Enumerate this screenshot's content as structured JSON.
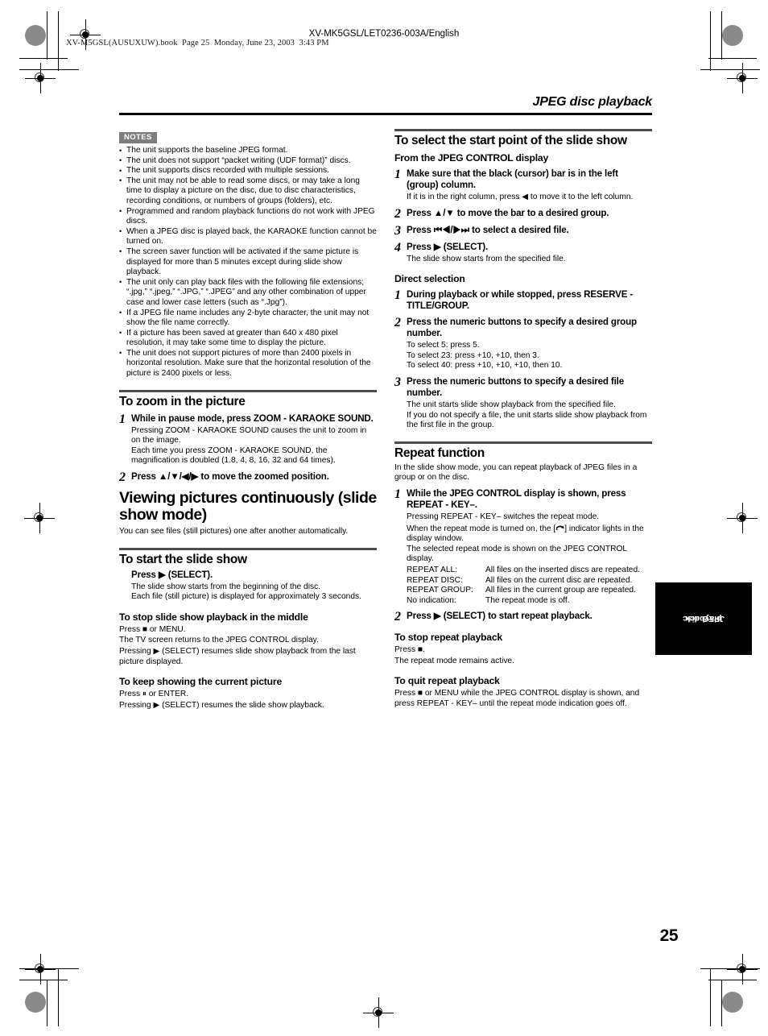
{
  "print": {
    "filestamp": "XV-M5GSL(AUSUXUW).book  Page 25  Monday, June 23, 2003  3:43 PM",
    "model_header": "XV-MK5GSL/LET0236-003A/English",
    "page_number": "25"
  },
  "chapter": {
    "title": "JPEG disc playback",
    "side_tab_line1": "JPEG disc",
    "side_tab_line2": "playback"
  },
  "notes": {
    "badge": "NOTES",
    "items": [
      "The unit supports the baseline JPEG format.",
      "The unit does not support “packet writing (UDF format)” discs.",
      "The unit supports discs recorded with multiple sessions.",
      "The unit may not be able to read some discs, or may take a long time to display a picture on the disc, due to disc characteristics, recording conditions, or numbers of groups (folders), etc.",
      "Programmed and random playback functions do not work with JPEG discs.",
      "When a JPEG disc is played back, the KARAOKE function cannot be turned on.",
      "The screen saver function will be activated if the same picture is displayed for more than 5 minutes except during slide show playback.",
      "The unit only can play back files with the following file extensions; “.jpg,” “.jpeg,” “.JPG,” “.JPEG” and any other combination of upper case and lower case letters (such as “.Jpg”).",
      "If a JPEG file name includes any 2-byte character, the unit may not show the file name correctly.",
      "If a picture has been saved at greater than 640 x 480 pixel resolution, it may take some time to display the picture.",
      "The unit does not support pictures of more than 2400 pixels in horizontal resolution. Make sure that the horizontal resolution of the picture is 2400 pixels or less."
    ]
  },
  "zoom_section": {
    "heading": "To zoom in the picture",
    "step1_num": "1",
    "step1_title": "While in pause mode, press ZOOM - KARAOKE SOUND.",
    "step1_note_a": "Pressing ZOOM - KARAOKE SOUND causes the unit to zoom in on the image.",
    "step1_note_b": "Each time you press ZOOM - KARAOKE SOUND, the magnification is doubled (1.8, 4, 8, 16, 32 and 64 times).",
    "step2_num": "2",
    "step2_title": "Press ▲/▼/◀/▶ to move the zoomed position."
  },
  "slideshow": {
    "title": "Viewing pictures continuously (slide show mode)",
    "lead": "You can see files (still pictures) one after another automatically.",
    "start_heading": "To start the slide show",
    "start_press": "Press ▶ (SELECT).",
    "start_note_a": "The slide show starts from the beginning of the disc.",
    "start_note_b": "Each file (still picture) is displayed for approximately 3 seconds.",
    "stop_heading": "To stop slide show playback in the middle",
    "stop_note_a": "Press ■ or MENU.",
    "stop_note_b": "The TV screen returns to the JPEG CONTROL display.",
    "stop_note_c": "Pressing ▶ (SELECT) resumes slide show playback from the last picture displayed.",
    "keep_heading": "To keep showing the current picture",
    "keep_note_a": "Press ⏸ or ENTER.",
    "keep_note_b": "Pressing ▶ (SELECT)  resumes the slide show playback."
  },
  "startpoint": {
    "heading": "To select the start point of the slide show",
    "from_display_heading": "From the JPEG CONTROL display",
    "steps": [
      {
        "num": "1",
        "title": "Make sure that the black (cursor) bar is in the left (group) column.",
        "note": "If it is in the right column, press ◀ to move it to the left column."
      },
      {
        "num": "2",
        "title": "Press ▲/▼  to move the bar to a desired group.",
        "note": ""
      },
      {
        "num": "3",
        "title": "Press ⏮◀/▶⏭  to select a desired file.",
        "note": ""
      },
      {
        "num": "4",
        "title": "Press ▶ (SELECT).",
        "note": "The slide show starts from the specified file."
      }
    ],
    "direct_heading": "Direct selection",
    "direct_steps": [
      {
        "num": "1",
        "title": "During playback or while stopped, press RESERVE - TITLE/GROUP.",
        "notes": []
      },
      {
        "num": "2",
        "title": "Press the numeric buttons to specify a desired group number.",
        "notes": [
          "To select 5: press 5.",
          "To select 23: press +10, +10, then 3.",
          "To select 40: press +10, +10, +10, then 10."
        ]
      },
      {
        "num": "3",
        "title": "Press the numeric buttons to specify a desired file number.",
        "notes": [
          "The unit starts slide show playback from the specified file.",
          "If you do not specify a file, the unit starts slide show playback from the first file in the group."
        ]
      }
    ]
  },
  "repeat": {
    "heading": "Repeat function",
    "lead": "In the slide show mode, you can repeat playback of JPEG files in a group or on the disc.",
    "step1_num": "1",
    "step1_title": "While the JPEG CONTROL display is shown, press REPEAT - KEY–.",
    "step1_note_a": "Pressing REPEAT - KEY– switches the repeat mode.",
    "step1_note_b_pre": "When the repeat mode is turned on, the [",
    "step1_note_b_post": "] indicator lights in the display window.",
    "step1_note_c": "The selected repeat mode is shown on the JPEG CONTROL display.",
    "modes": [
      {
        "term": "REPEAT ALL:",
        "desc": "All files on the inserted discs are repeated."
      },
      {
        "term": "REPEAT DISC:",
        "desc": "All files on the current disc are repeated."
      },
      {
        "term": "REPEAT GROUP:",
        "desc": "All files in the current group are repeated."
      },
      {
        "term": "No indication:",
        "desc": "The repeat mode is off."
      }
    ],
    "step2_num": "2",
    "step2_title": "Press ▶ (SELECT) to start repeat playback.",
    "stop_heading": "To stop repeat playback",
    "stop_note_a": "Press ■.",
    "stop_note_b": "The repeat mode remains active.",
    "quit_heading": "To quit repeat playback",
    "quit_note": "Press ■ or MENU while the JPEG CONTROL display is shown, and press REPEAT - KEY– until the repeat mode indication goes off."
  }
}
